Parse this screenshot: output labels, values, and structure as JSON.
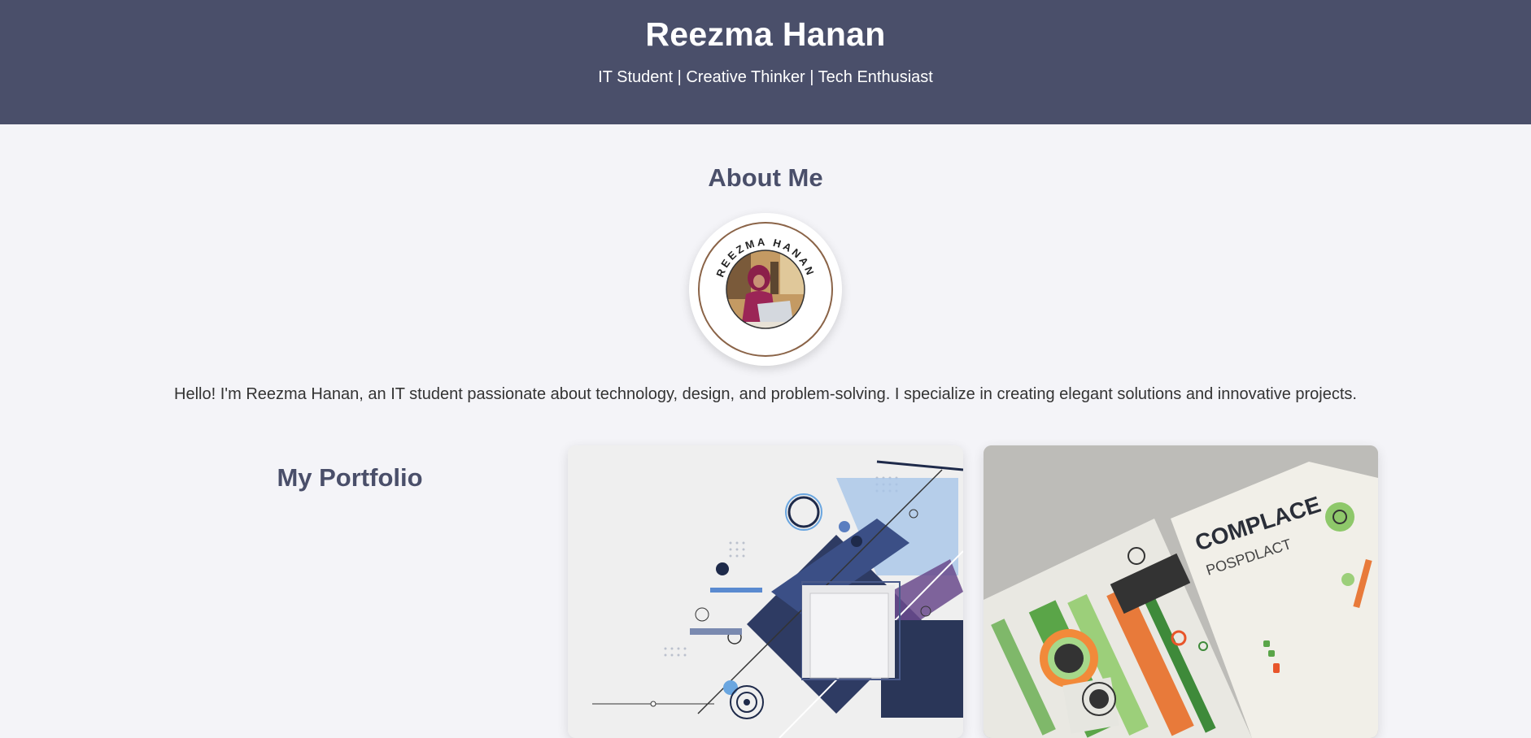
{
  "header": {
    "name": "Reezma Hanan",
    "tagline": "IT Student | Creative Thinker | Tech Enthusiast"
  },
  "about": {
    "title": "About Me",
    "avatar_ring_text": "REEZMA HANAN",
    "intro": "Hello! I'm Reezma Hanan, an IT student passionate about technology, design, and problem-solving. I specialize in creating elegant solutions and innovative projects."
  },
  "portfolio": {
    "title": "My Portfolio",
    "cards": [
      {
        "kind": "abstract-geometric-artwork"
      },
      {
        "kind": "brochure-mockup-artwork",
        "cover_text": "COMPLACE",
        "cover_subtext": "POSPDLACT"
      }
    ]
  },
  "colors": {
    "header_bg": "#4a4f6a",
    "page_bg": "#f4f4f8",
    "heading": "#4a4f6a"
  }
}
